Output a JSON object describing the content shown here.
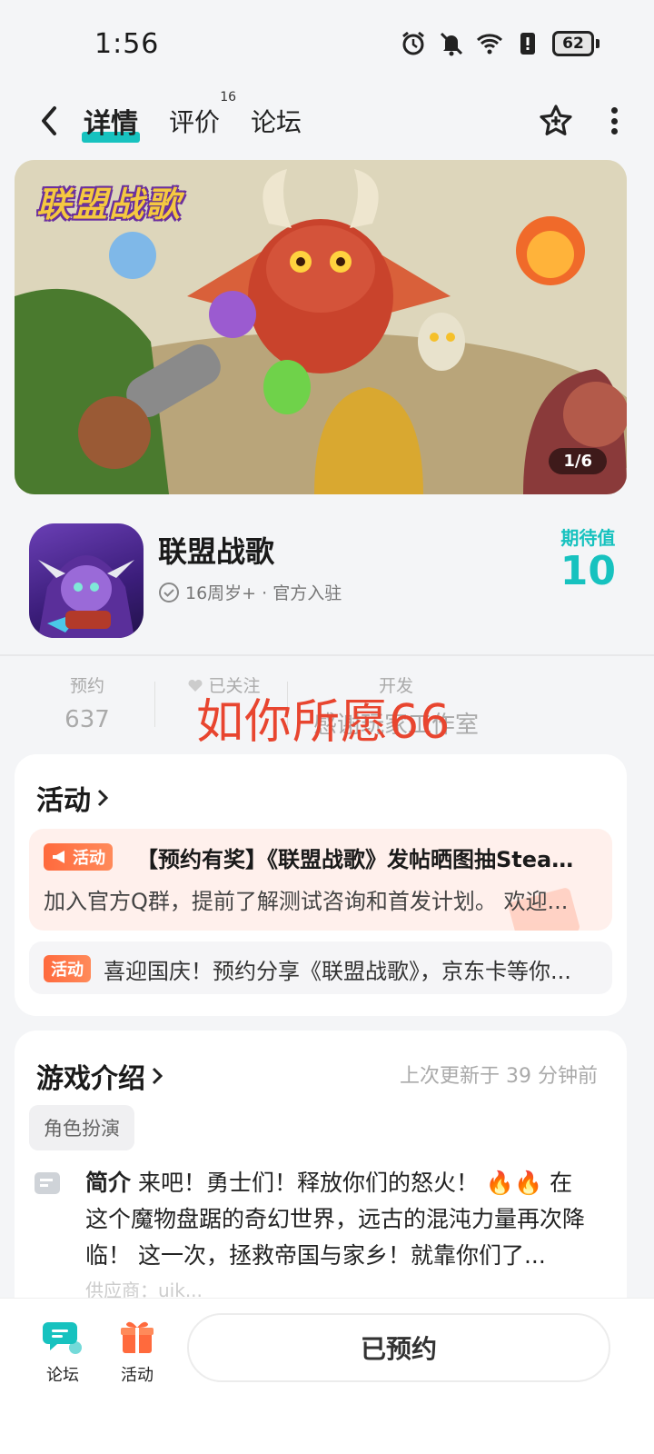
{
  "status_bar": {
    "time": "1:56",
    "battery": "62",
    "icons": [
      "alarm-icon",
      "mute-icon",
      "wifi-icon",
      "alert-icon",
      "battery-icon"
    ]
  },
  "nav": {
    "tabs": [
      {
        "label": "详情",
        "active": true
      },
      {
        "label": "评价",
        "badge": "16"
      },
      {
        "label": "论坛"
      }
    ]
  },
  "banner": {
    "logo_text": "联盟战歌",
    "counter": "1/6"
  },
  "app": {
    "name": "联盟战歌",
    "meta": "16周岁+ · 官方入驻",
    "expect_label": "期待值",
    "expect_value": "10"
  },
  "stats": {
    "reserve_label": "预约",
    "reserve_value": "637",
    "follow_label": "已关注",
    "dev_label": "开发",
    "dev_value": "感谢玩家工作室"
  },
  "overlay_text": "如你所愿66",
  "activity": {
    "title": "活动",
    "items": [
      {
        "tag": "活动",
        "title": "【预约有奖】《联盟战歌》发帖晒图抽Steam...",
        "desc": "加入官方Q群，提前了解测试咨询和首发计划。 欢迎..."
      },
      {
        "tag": "活动",
        "title": "喜迎国庆！预约分享《联盟战歌》，京东卡等你..."
      }
    ]
  },
  "intro": {
    "title": "游戏介绍",
    "updated": "上次更新于 39 分钟前",
    "genre": "角色扮演",
    "brief_label": "简介",
    "brief_text": " 来吧！勇士们！释放你们的怒火！ 🔥🔥 在这个魔物盘踞的奇幻世界，远古的混沌力量再次降临！ 这一次，拯救帝国与家乡！就靠你们了...",
    "fade_line": "供应商：uik..."
  },
  "bottom_bar": {
    "forum_label": "论坛",
    "activity_label": "活动",
    "reserve_button": "已预约"
  },
  "colors": {
    "accent": "#17c2bf",
    "activity_orange": "#ff6a3d",
    "overlay_red": "#e8452f"
  }
}
